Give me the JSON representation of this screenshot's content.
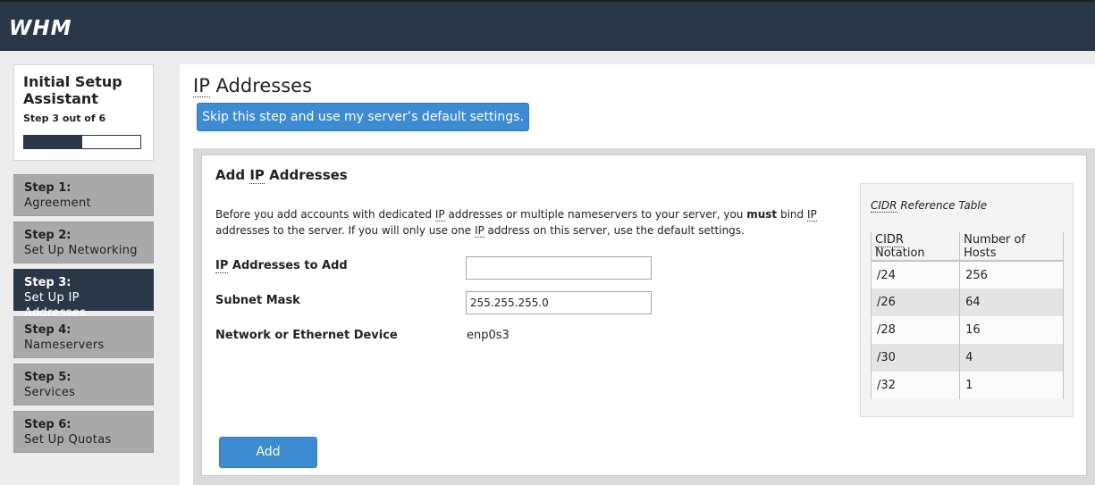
{
  "header": {
    "logo": "WHM"
  },
  "sidebar": {
    "title": "Initial Setup Assistant",
    "step_progress": "Step 3 out of 6",
    "progress_fraction": 0.5,
    "steps": [
      {
        "number": "Step 1:",
        "name": "Agreement",
        "active": false
      },
      {
        "number": "Step 2:",
        "name": "Set Up Networking",
        "active": false
      },
      {
        "number": "Step 3:",
        "name": "Set Up IP Addresses",
        "active": true
      },
      {
        "number": "Step 4:",
        "name": "Nameservers",
        "active": false
      },
      {
        "number": "Step 5:",
        "name": "Services",
        "active": false
      },
      {
        "number": "Step 6:",
        "name": "Set Up Quotas",
        "active": false
      }
    ]
  },
  "main": {
    "title_abbr": "IP",
    "title_rest": " Addresses",
    "skip_label": "Skip this step and use my server’s default settings.",
    "panel": {
      "title_pre": "Add ",
      "title_abbr": "IP",
      "title_post": " Addresses",
      "desc_1": "Before you add accounts with dedicated ",
      "desc_ip": "IP",
      "desc_2": " addresses or multiple nameservers to your server, you ",
      "desc_must": "must",
      "desc_3": " bind ",
      "desc_4": " addresses to the server. If you will only use one ",
      "desc_5": " address on this server, use the default settings.",
      "ip_label_abbr": "IP",
      "ip_label_rest": " Addresses to Add",
      "ip_value": "",
      "subnet_label": "Subnet Mask",
      "subnet_value": "255.255.255.0",
      "device_label": "Network or Ethernet Device",
      "device_value": "enp0s3",
      "add_label": "Add"
    },
    "cidr": {
      "caption_abbr": "CIDR",
      "caption_rest": " Reference Table",
      "header_notation_abbr": "CIDR",
      "header_notation_rest": " Notation",
      "header_hosts": "Number of Hosts",
      "rows": [
        {
          "notation": "/24",
          "hosts": "256"
        },
        {
          "notation": "/26",
          "hosts": "64"
        },
        {
          "notation": "/28",
          "hosts": "16"
        },
        {
          "notation": "/30",
          "hosts": "4"
        },
        {
          "notation": "/32",
          "hosts": "1"
        }
      ]
    }
  }
}
